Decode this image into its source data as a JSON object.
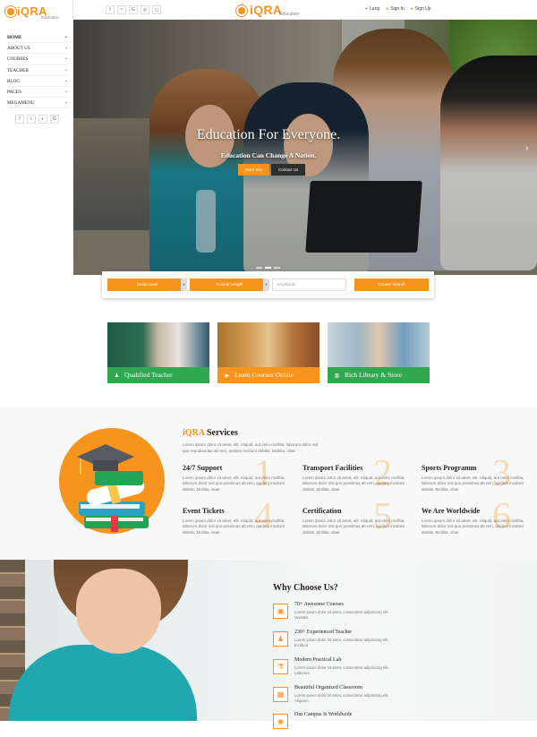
{
  "brand": {
    "name": "iQRA",
    "tagline": "Education"
  },
  "sidebar": {
    "items": [
      {
        "label": "HOME"
      },
      {
        "label": "ABOUT US"
      },
      {
        "label": "COURSES"
      },
      {
        "label": "TEACHER"
      },
      {
        "label": "BLOG"
      },
      {
        "label": "PAGES"
      },
      {
        "label": "MEGAMENU"
      }
    ],
    "social": [
      {
        "icon": "facebook-icon",
        "glyph": "f"
      },
      {
        "icon": "twitter-icon",
        "glyph": "t"
      },
      {
        "icon": "github-icon",
        "glyph": "◐"
      },
      {
        "icon": "google-icon",
        "glyph": "G"
      }
    ]
  },
  "topbar": {
    "social": [
      {
        "icon": "facebook-icon",
        "glyph": "f"
      },
      {
        "icon": "rss-icon",
        "glyph": "≈"
      },
      {
        "icon": "google-icon",
        "glyph": "G"
      },
      {
        "icon": "dribbble-icon",
        "glyph": "◎"
      },
      {
        "icon": "instagram-icon",
        "glyph": "◻"
      }
    ],
    "links": {
      "lang": "Lang",
      "signin": "Sign In",
      "signup": "Sign Up"
    }
  },
  "hero": {
    "title": "Education For Everyone.",
    "subtitle": "Education Can Change A Nation.",
    "btn_more": "More Info",
    "btn_contact": "Contact Us"
  },
  "search": {
    "study_level": "Study Level",
    "course_length": "Course Length",
    "keywords_placeholder": "KeyWords",
    "submit": "Course Search"
  },
  "cards": [
    {
      "label": "Qualified Teacher"
    },
    {
      "label": "Learn Courses Online"
    },
    {
      "label": "Rich Library & Store"
    }
  ],
  "services": {
    "title_brand": "iQRA",
    "title_rest": " Services",
    "intro": "Lorem ipsum dolor sit amet, elit. Aliquid, aut enim mollitia, laborum dolor nisl quo repudiandae ab rem, quidem incidunt debitis. Mollitia, vitae",
    "items": [
      {
        "title": "24/7 Support",
        "num": "1",
        "desc": "Lorem ipsum dolor sit amet, elit. Aliquid, aut enim mollitia, laborum dolor nisl quo possimus ab rem, quidem incidunt debitis. Mollitia, vitae"
      },
      {
        "title": "Transport Facilities",
        "num": "2",
        "desc": "Lorem ipsum dolor sit amet, elit. Aliquid, aut enim mollitia, laborum dolor nisl quo possimus ab rem, quidem incidunt debitis. Mollitia, vitae"
      },
      {
        "title": "Sports Programm",
        "num": "3",
        "desc": "Lorem ipsum dolor sit amet, elit. Aliquid, aut enim mollitia, laborum dolor nisl quo possimus ab rem, quidem incidunt debitis. Mollitia, vitae"
      },
      {
        "title": "Event Tickets",
        "num": "4",
        "desc": "Lorem ipsum dolor sit amet, elit. Aliquid, aut enim mollitia, laborum dolor nisl quo possimus ab rem, quidem incidunt debitis. Mollitia, vitae"
      },
      {
        "title": "Certification",
        "num": "5",
        "desc": "Lorem ipsum dolor sit amet, elit. Aliquid, aut enim mollitia, laborum dolor nisl quo possimus ab rem, quidem incidunt debitis. Mollitia, vitae"
      },
      {
        "title": "We Are Worldwide",
        "num": "6",
        "desc": "Lorem ipsum dolor sit amet, elit. Aliquid, aut enim mollitia, laborum dolor nisl quo possimus ab rem, quidem incidunt debitis. Mollitia, vitae"
      }
    ]
  },
  "why": {
    "title": "Why Choose Us?",
    "items": [
      {
        "title": "70+ Awesome Courses",
        "desc": "Lorem ipsum dolor sit amet, consectetur adipisicing elit. Veritatis.",
        "glyph": "▣"
      },
      {
        "title": "230+ Experienced Teacher",
        "desc": "Lorem ipsum dolor sit amet, consectetur adipisicing elit. Incidunt",
        "glyph": "♟"
      },
      {
        "title": "Modern Practical Lab",
        "desc": "Lorem ipsum dolor sit amet, consectetur adipisicing elit. Laborum",
        "glyph": "⚗"
      },
      {
        "title": "Beautiful Organized Classroom",
        "desc": "Lorem ipsum dolor sit amet, consectetur adipisicing elit. Aliquam.",
        "glyph": "▦"
      },
      {
        "title": "Our Campus Is Worldwide",
        "desc": "",
        "glyph": "◉"
      }
    ]
  },
  "colors": {
    "accent": "#f7941d",
    "green": "#2fa84f"
  }
}
